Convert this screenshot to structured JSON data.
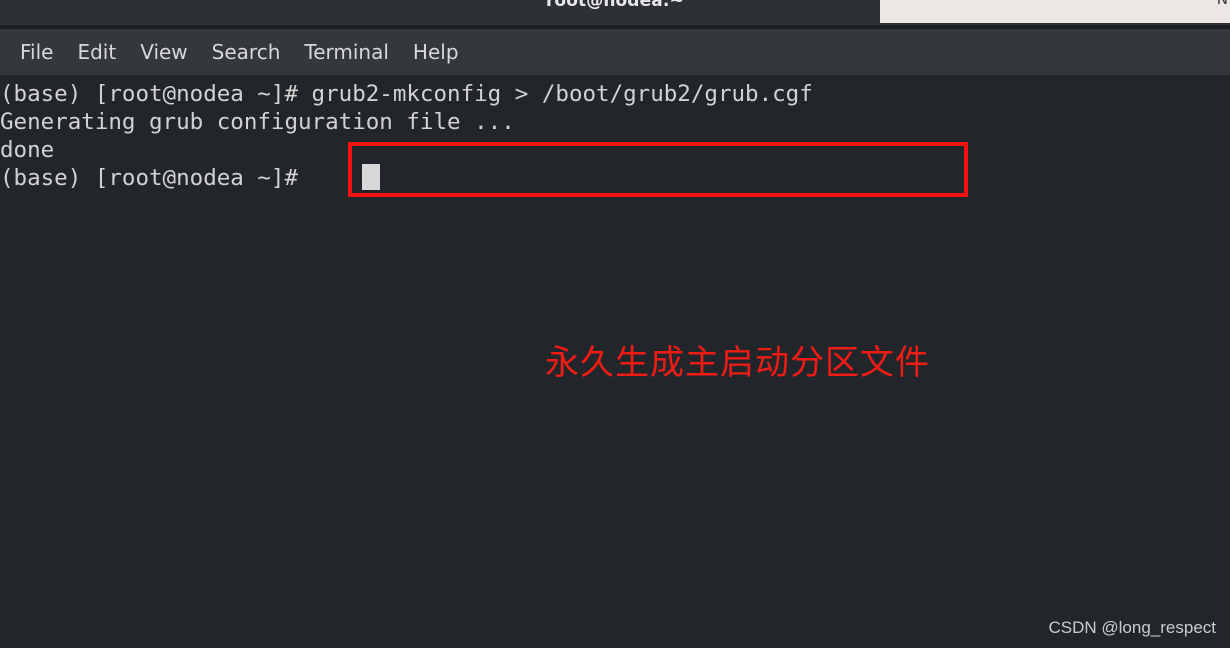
{
  "window": {
    "title": "root@nodea:~",
    "overlay_panel_mark": "N"
  },
  "menu": {
    "items": [
      {
        "label": "File"
      },
      {
        "label": "Edit"
      },
      {
        "label": "View"
      },
      {
        "label": "Search"
      },
      {
        "label": "Terminal"
      },
      {
        "label": "Help"
      }
    ]
  },
  "terminal": {
    "lines": [
      "(base) [root@nodea ~]# grub2-mkconfig > /boot/grub2/grub.cgf",
      "Generating grub configuration file ...",
      "done",
      "(base) [root@nodea ~]# "
    ],
    "command_highlighted": "grub2-mkconfig > /boot/grub2/grub.cgf",
    "prompt": "(base) [root@nodea ~]#"
  },
  "annotations": {
    "chinese_note": "永久生成主启动分区文件",
    "highlight_color": "#f31212",
    "note_color": "#ef1c16"
  },
  "watermark": {
    "text": "CSDN @long_respect"
  },
  "colors": {
    "titlebar_bg": "#2d3135",
    "menubar_bg": "#34383c",
    "terminal_bg": "#22262a",
    "terminal_text": "#d2d2d2",
    "overlay_panel_bg": "#eae7e4"
  }
}
